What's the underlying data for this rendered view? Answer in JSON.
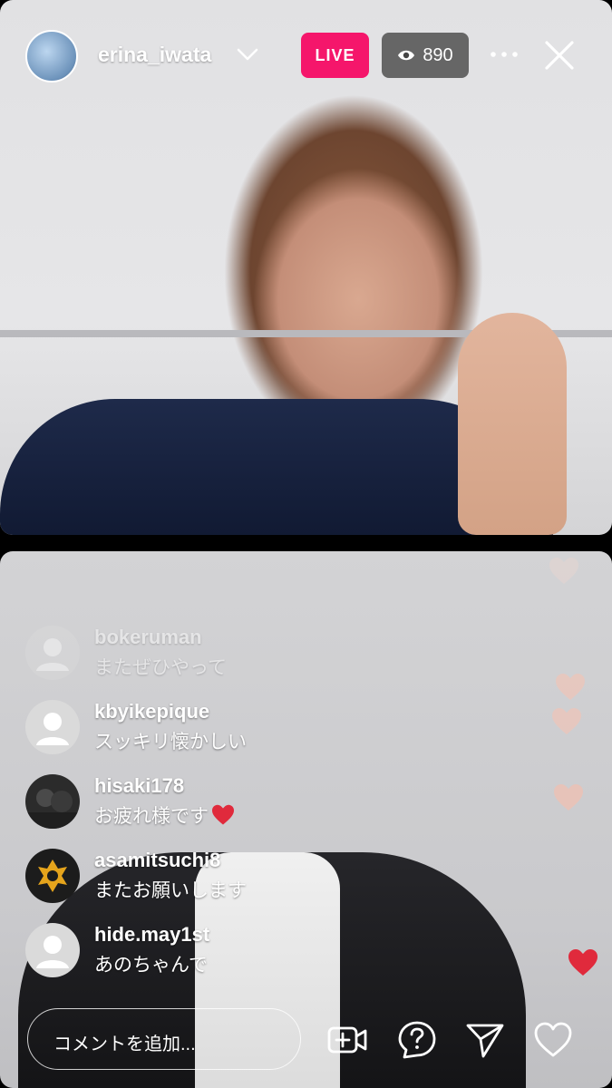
{
  "header": {
    "username": "erina_iwata",
    "live_label": "LIVE",
    "viewer_count": "890"
  },
  "comments": [
    {
      "user": "bokeruman",
      "text": "またぜひやって",
      "avatar": "default"
    },
    {
      "user": "kbyikepique",
      "text": "スッキリ懐かしい",
      "avatar": "default"
    },
    {
      "user": "hisaki178",
      "text": "お疲れ様です",
      "avatar": "photo"
    },
    {
      "user": "asamitsuchi8",
      "text": "またお願いします",
      "avatar": "logo"
    },
    {
      "user": "hide.may1st",
      "text": "あのちゃんで",
      "avatar": "default"
    }
  ],
  "comment_input": {
    "placeholder": "コメントを追加..."
  },
  "colors": {
    "live_badge": "#f5166b",
    "heart": "#e02a3c"
  },
  "icons": [
    "chevron-down-icon",
    "eye-icon",
    "more-icon",
    "close-icon",
    "add-video-icon",
    "question-icon",
    "send-icon",
    "heart-icon"
  ]
}
